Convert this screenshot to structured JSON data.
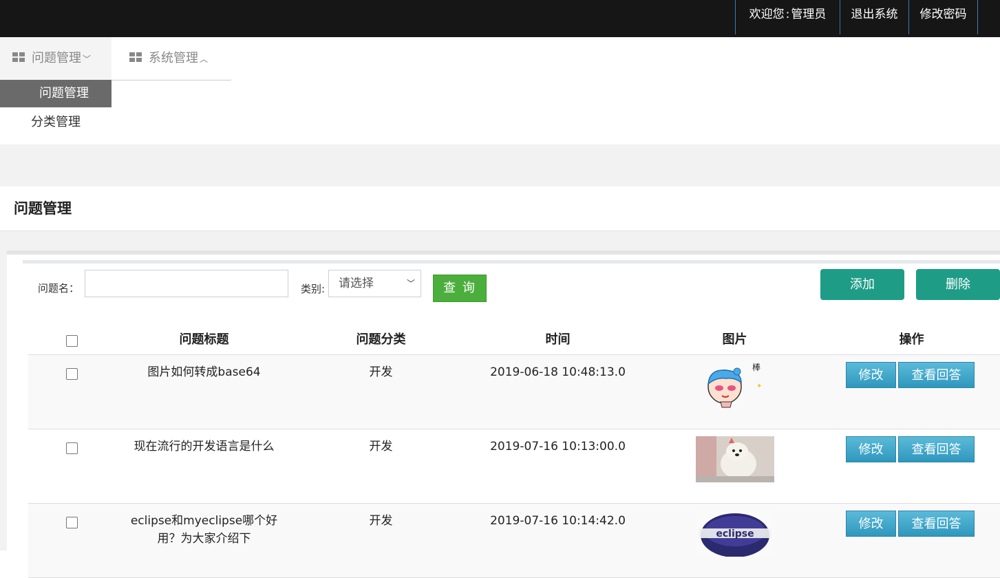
{
  "header": {
    "welcome_label": "欢迎您",
    "user_name": "管理员",
    "logout": "退出系统",
    "change_password": "修改密码"
  },
  "menu": {
    "problem_management": "问题管理",
    "system_management": "系统管理",
    "submenu": [
      "问题管理",
      "分类管理"
    ]
  },
  "page": {
    "title": "问题管理"
  },
  "search": {
    "name_label": "问题名：",
    "name_value": "",
    "category_label": "类别:",
    "category_selected": "请选择",
    "query_button": "查 询",
    "add_button": "添加",
    "delete_button": "删除"
  },
  "table": {
    "columns": [
      "问题标题",
      "问题分类",
      "时间",
      "图片",
      "操作"
    ],
    "rows": [
      {
        "title": "图片如何转成base64",
        "category": "开发",
        "time": "2019-06-18 10:48:13.0",
        "image": "cartoon-boy-thumbnail",
        "edit": "修改",
        "view": "查看回答"
      },
      {
        "title": "现在流行的开发语言是什么",
        "category": "开发",
        "time": "2019-07-16 10:13:00.0",
        "image": "dog-photo-thumbnail",
        "edit": "修改",
        "view": "查看回答"
      },
      {
        "title": "eclipse和myeclipse哪个好用？为大家介绍下",
        "category": "开发",
        "time": "2019-07-16 10:14:42.0",
        "image": "eclipse-logo-thumbnail",
        "edit": "修改",
        "view": "查看回答"
      }
    ]
  },
  "colors": {
    "topbar": "#161616",
    "green_button": "#1e9c86",
    "query_button": "#4cae3c",
    "blue_button": "#2f97bd",
    "active_submenu": "#6a6a6a"
  }
}
